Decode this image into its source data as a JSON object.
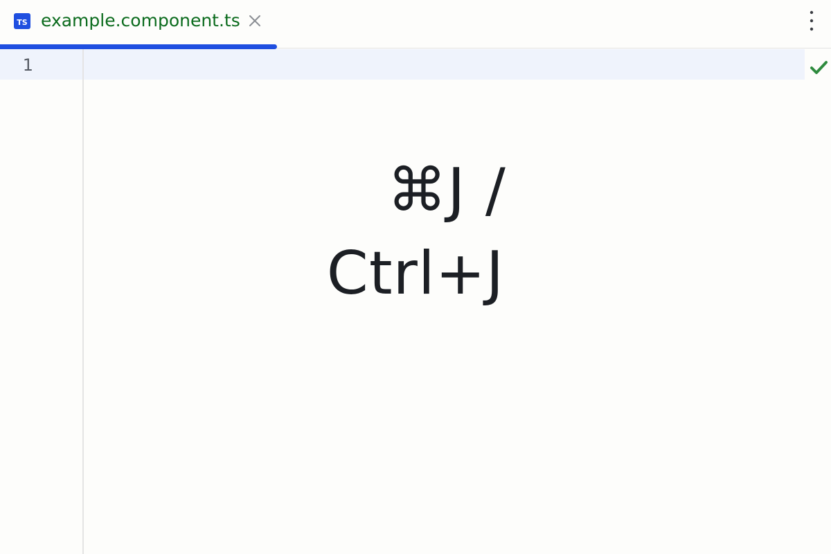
{
  "tabs": [
    {
      "icon": "typescript-file-icon",
      "icon_text": "TS",
      "title": "example.component.ts",
      "active": true
    }
  ],
  "toolbar": {
    "more_icon": "more-vertical-icon"
  },
  "editor": {
    "lines": [
      {
        "number": "1",
        "content": ""
      }
    ],
    "status_icon": "check-icon"
  },
  "overlay": {
    "line1": "⌘J /",
    "line2": "Ctrl+J"
  },
  "colors": {
    "accent": "#1f4fe0",
    "tab_title": "#0b6b1d",
    "status_ok": "#2e8b3e",
    "current_line_bg": "#eff3fc"
  }
}
